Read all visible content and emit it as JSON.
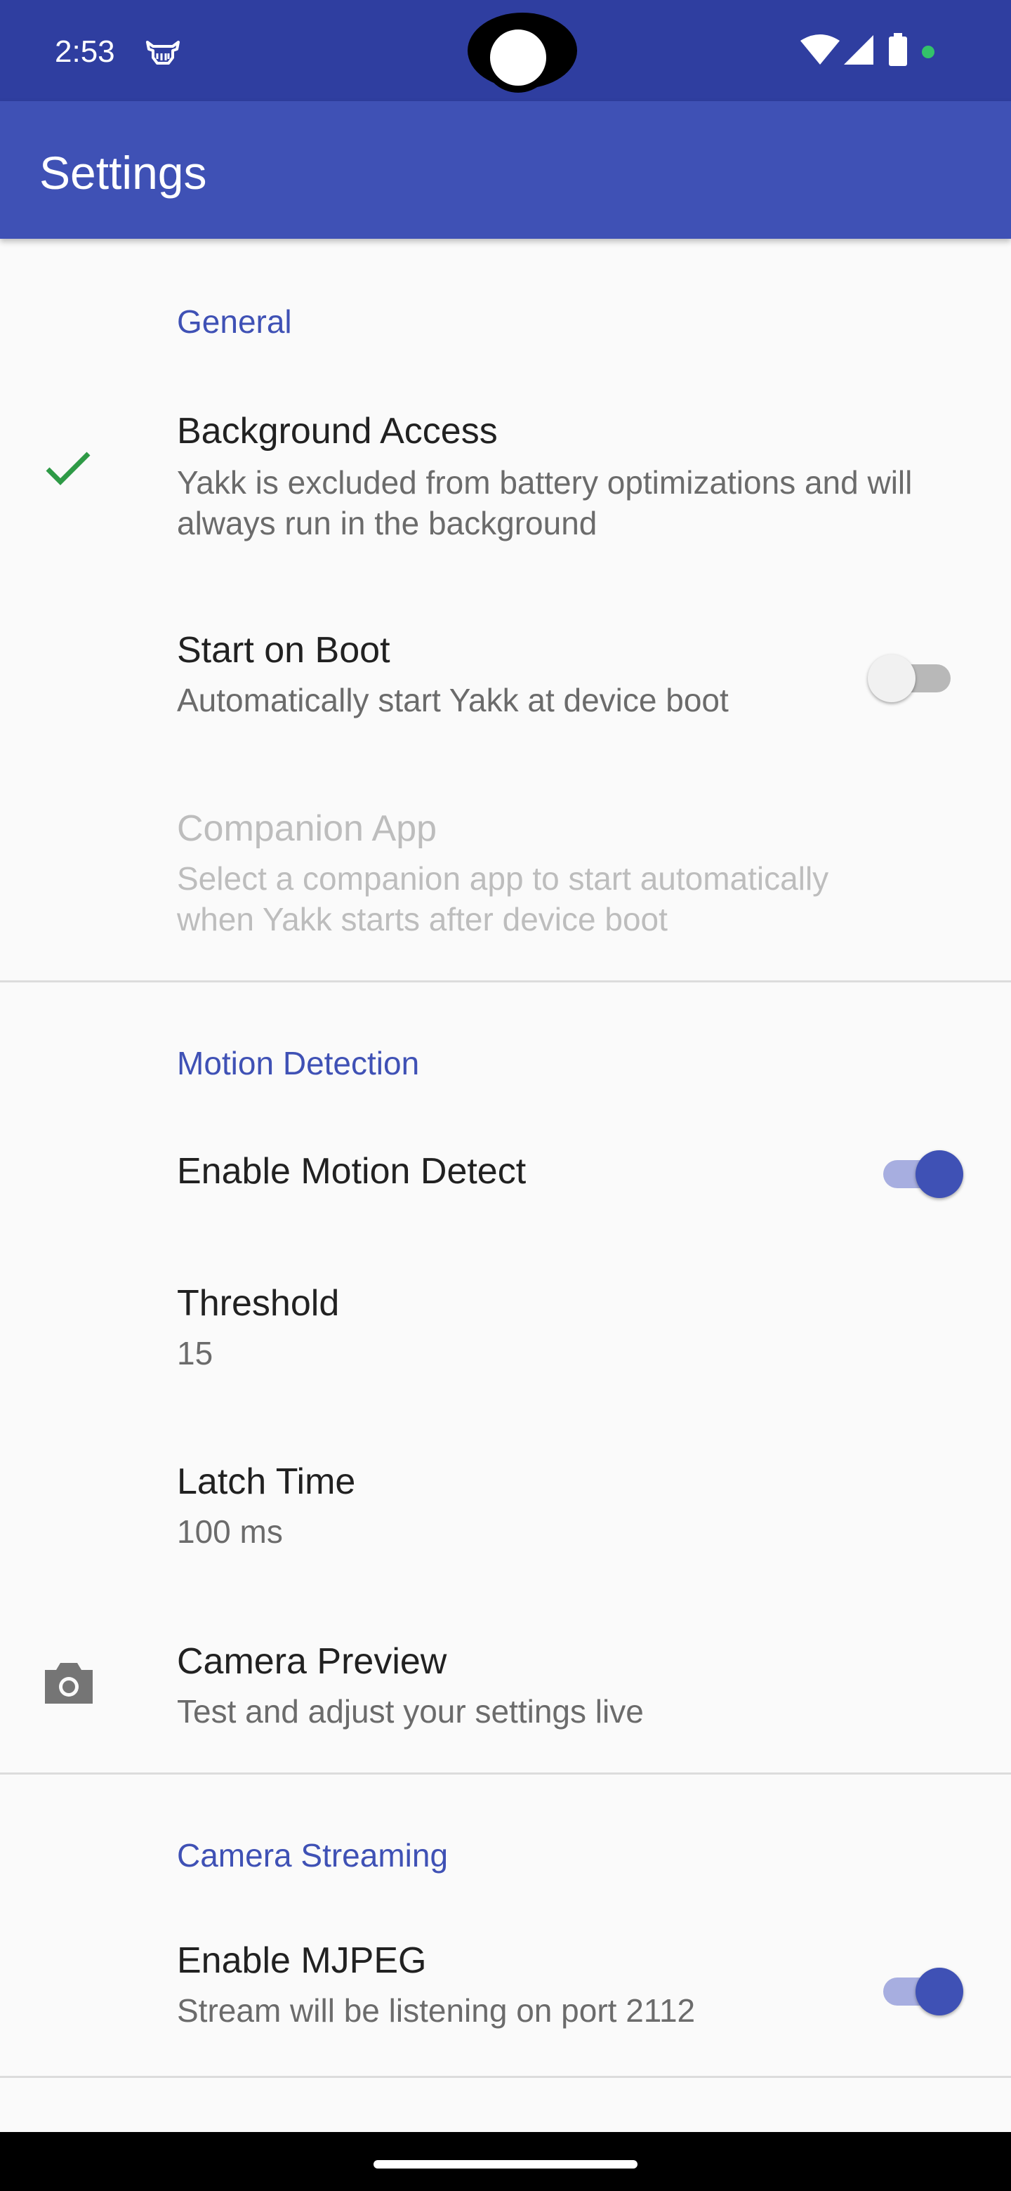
{
  "status_bar": {
    "time": "2:53"
  },
  "app_bar": {
    "title": "Settings"
  },
  "colors": {
    "accent": "#3f51b5",
    "check": "#2e9a46"
  },
  "general": {
    "category": "General",
    "background_access": {
      "title": "Background Access",
      "summary": "Yakk is excluded from battery optimizations and will always run in the background",
      "icon": "check-icon"
    },
    "start_on_boot": {
      "title": "Start on Boot",
      "summary": "Automatically start Yakk at device boot",
      "enabled": false
    },
    "companion_app": {
      "title": "Companion App",
      "summary": "Select a companion app to start automatically when Yakk starts after device boot"
    }
  },
  "motion_detection": {
    "category": "Motion Detection",
    "enable_motion_detect": {
      "title": "Enable Motion Detect",
      "enabled": true
    },
    "threshold": {
      "title": "Threshold",
      "summary": "15"
    },
    "latch_time": {
      "title": "Latch Time",
      "summary": "100 ms"
    },
    "camera_preview": {
      "title": "Camera Preview",
      "summary": "Test and adjust your settings live",
      "icon": "camera-icon"
    }
  },
  "camera_streaming": {
    "category": "Camera Streaming",
    "enable_mjpeg": {
      "title": "Enable MJPEG",
      "summary": "Stream will be listening on port 2112",
      "enabled": true
    }
  }
}
